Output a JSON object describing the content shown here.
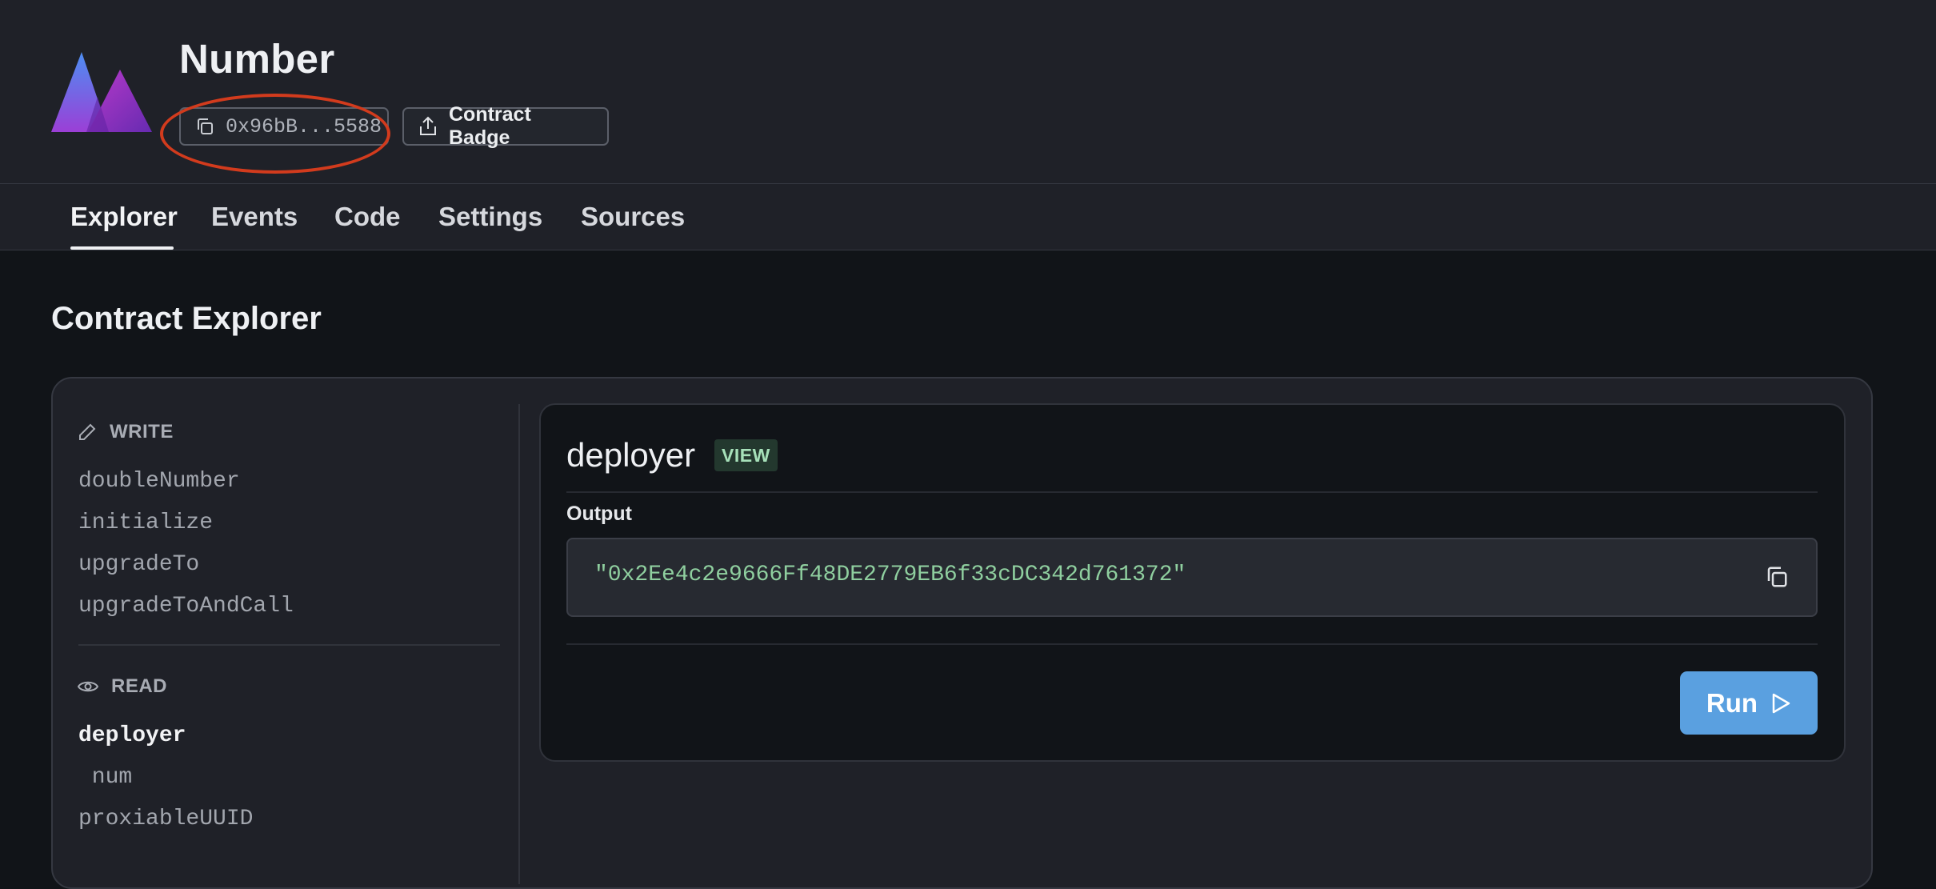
{
  "contract": {
    "name": "Number",
    "address_short": "0x96bB...5588",
    "badge_label": "Contract Badge"
  },
  "tabs": [
    {
      "label": "Explorer",
      "active": true
    },
    {
      "label": "Events",
      "active": false
    },
    {
      "label": "Code",
      "active": false
    },
    {
      "label": "Settings",
      "active": false
    },
    {
      "label": "Sources",
      "active": false
    }
  ],
  "explorer": {
    "title": "Contract Explorer",
    "write": {
      "label": "WRITE",
      "icon": "pencil-icon",
      "functions": [
        "doubleNumber",
        "initialize",
        "upgradeTo",
        "upgradeToAndCall"
      ]
    },
    "read": {
      "label": "READ",
      "icon": "eye-icon",
      "functions": [
        "deployer",
        " num",
        "proxiableUUID"
      ]
    },
    "selected": {
      "name": "deployer",
      "badge": "VIEW",
      "output_label": "Output",
      "output_value": "\"0x2Ee4c2e9666Ff48DE2779EB6f33cDC342d761372\"",
      "run_label": "Run"
    }
  },
  "colors": {
    "header_bg": "#1f2128",
    "page_bg": "#111418",
    "accent_run": "#5aa0e0",
    "output_text": "#8fcf9f",
    "annotation": "#d23b1d"
  }
}
